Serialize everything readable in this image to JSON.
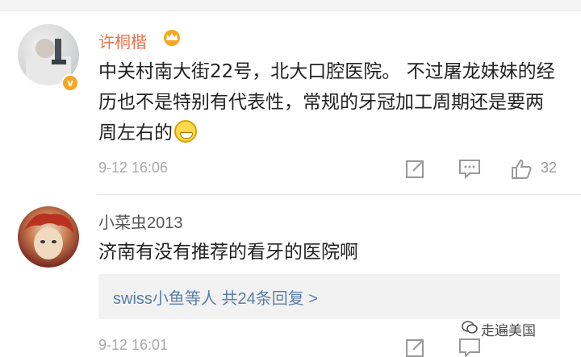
{
  "comments": [
    {
      "username": "许桐楷",
      "text": "中关村南大街22号，北大口腔医院。 不过屠龙妹妹的经历也不是特别有代表性，常规的牙冠加工周期还是要两周左右的",
      "timestamp": "9-12 16:06",
      "likes": "32",
      "verified_badge": "v",
      "name_color": "#eb7350"
    },
    {
      "username": "小菜虫2013",
      "text": "济南有没有推荐的看牙的医院啊",
      "timestamp": "9-12 16:01",
      "replies_summary": "swiss小鱼等人  共24条回复 >"
    }
  ],
  "watermark": "走遍美国",
  "icons": [
    "share-edit-icon",
    "comment-icon",
    "like-icon",
    "crown-icon",
    "wechat-icon",
    "grin-emoji-icon"
  ],
  "colors": {
    "link": "#5a7fa6",
    "meta": "#aaaaaa",
    "highlight_name": "#eb7350"
  }
}
